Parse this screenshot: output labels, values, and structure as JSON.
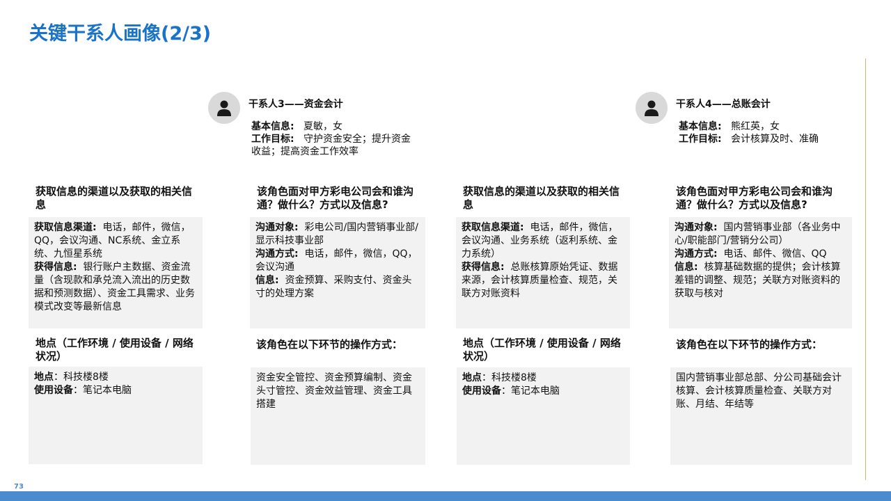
{
  "page": {
    "title": "关键干系人画像(2/3)",
    "page_number": "73"
  },
  "personas": [
    {
      "name": "干系人3——资金会计",
      "basic_label": "基本信息:",
      "basic_value": "夏敏，女",
      "goal_label": "工作目标:",
      "goal_value": "守护资金安全；提升资金收益；提高资金工作效率",
      "channels_heading": "获取信息的渠道以及获取的相关信息",
      "channels_label": "获取信息渠道:",
      "channels_value": "电话，邮件，微信，QQ，会议沟通、NC系统、金立系统、九恒星系统",
      "obtained_label": "获得信息:",
      "obtained_value": "银行账户主数据、资金流量（含现款和承兑流入流出的历史数据和预测数据）、资金工具需求、业务模式改变等最新信息",
      "location_heading": "地点（工作环境 / 使用设备 / 网络状况）",
      "location_label": "地点",
      "location_value": "科技楼8楼",
      "device_label": "使用设备",
      "device_value": "笔记本电脑",
      "comm_heading": "该角色面对甲方彩电公司会和谁沟通？做什么？方式以及信息?",
      "comm_target_label": "沟通对象:",
      "comm_target_value": "彩电公司/国内营销事业部/显示科技事业部",
      "comm_method_label": "沟通方式:",
      "comm_method_value": "电话，邮件，微信，QQ，会议沟通",
      "info_label": "信息:",
      "info_value": "资金预算、采购支付、资金头寸的处理方案",
      "ops_heading": "该角色在以下环节的操作方式：",
      "ops_value": "资金安全管控、资金预算编制、资金头寸管控、资金效益管理、资金工具搭建"
    },
    {
      "name": "干系人4——总账会计",
      "basic_label": "基本信息:",
      "basic_value": "熊红英，女",
      "goal_label": "工作目标:",
      "goal_value": "会计核算及时、准确",
      "channels_heading": "获取信息的渠道以及获取的相关信息",
      "channels_label": "获取信息渠道:",
      "channels_value": "电话，邮件，微信，会议沟通、业务系统（返利系统、金力系统）",
      "obtained_label": "获得信息:",
      "obtained_value": "总账核算原始凭证、数据来源，会计核算质量检查、规范，关联方对账资料",
      "location_heading": "地点（工作环境 / 使用设备 / 网络状况）",
      "location_label": "地点",
      "location_value": "科技楼8楼",
      "device_label": "使用设备",
      "device_value": "笔记本电脑",
      "comm_heading": "该角色面对甲方彩电公司会和谁沟通？做什么？方式以及信息?",
      "comm_target_label": "沟通对象:",
      "comm_target_value": "国内营销事业部（各业务中心/职能部门/营销分公司）",
      "comm_method_label": "沟通方式:",
      "comm_method_value": "电话、邮件、微信、QQ",
      "info_label": "信息:",
      "info_value": "核算基础数据的提供；会计核算差错的调整、规范；关联方对账资料的获取与核对",
      "ops_heading": "该角色在以下环节的操作方式：",
      "ops_value": "国内营销事业部总部、分公司基础会计核算、会计核算质量检查、关联方对账、月结、年结等"
    }
  ]
}
